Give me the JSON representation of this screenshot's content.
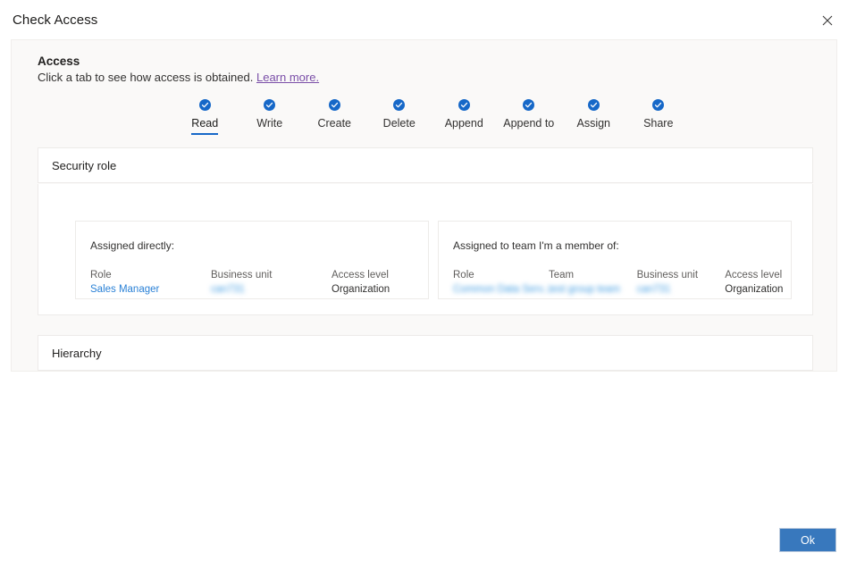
{
  "dialog": {
    "title": "Check Access",
    "close_icon": "close-icon"
  },
  "panel": {
    "heading": "Access",
    "subtitle": "Click a tab to see how access is obtained.",
    "learn_more": "Learn more."
  },
  "tabs": [
    {
      "label": "Read",
      "icon": "check-circle-icon",
      "active": true
    },
    {
      "label": "Write",
      "icon": "check-circle-icon",
      "active": false
    },
    {
      "label": "Create",
      "icon": "check-circle-icon",
      "active": false
    },
    {
      "label": "Delete",
      "icon": "check-circle-icon",
      "active": false
    },
    {
      "label": "Append",
      "icon": "check-circle-icon",
      "active": false
    },
    {
      "label": "Append to",
      "icon": "check-circle-icon",
      "active": false
    },
    {
      "label": "Assign",
      "icon": "check-circle-icon",
      "active": false
    },
    {
      "label": "Share",
      "icon": "check-circle-icon",
      "active": false
    }
  ],
  "sections": {
    "security_role": {
      "title": "Security role",
      "direct": {
        "caption": "Assigned directly:",
        "columns": [
          "Role",
          "Business unit",
          "Access level"
        ],
        "values": [
          "Sales Manager",
          "can731",
          "Organization"
        ]
      },
      "team": {
        "caption": "Assigned to team I'm a member of:",
        "columns": [
          "Role",
          "Team",
          "Business unit",
          "Access level"
        ],
        "values": [
          "Common Data Serv...",
          "test group team",
          "can731",
          "Organization"
        ]
      }
    },
    "hierarchy": {
      "title": "Hierarchy"
    }
  },
  "footer": {
    "ok_label": "Ok"
  },
  "colors": {
    "accent_blue": "#1668c8",
    "check_blue": "#1668c8",
    "link_blue": "#2a81d6",
    "learn_more_purple": "#7a4ea8",
    "button_blue": "#3878bd",
    "panel_bg": "#faf9f8",
    "card_border": "#edebe9"
  }
}
